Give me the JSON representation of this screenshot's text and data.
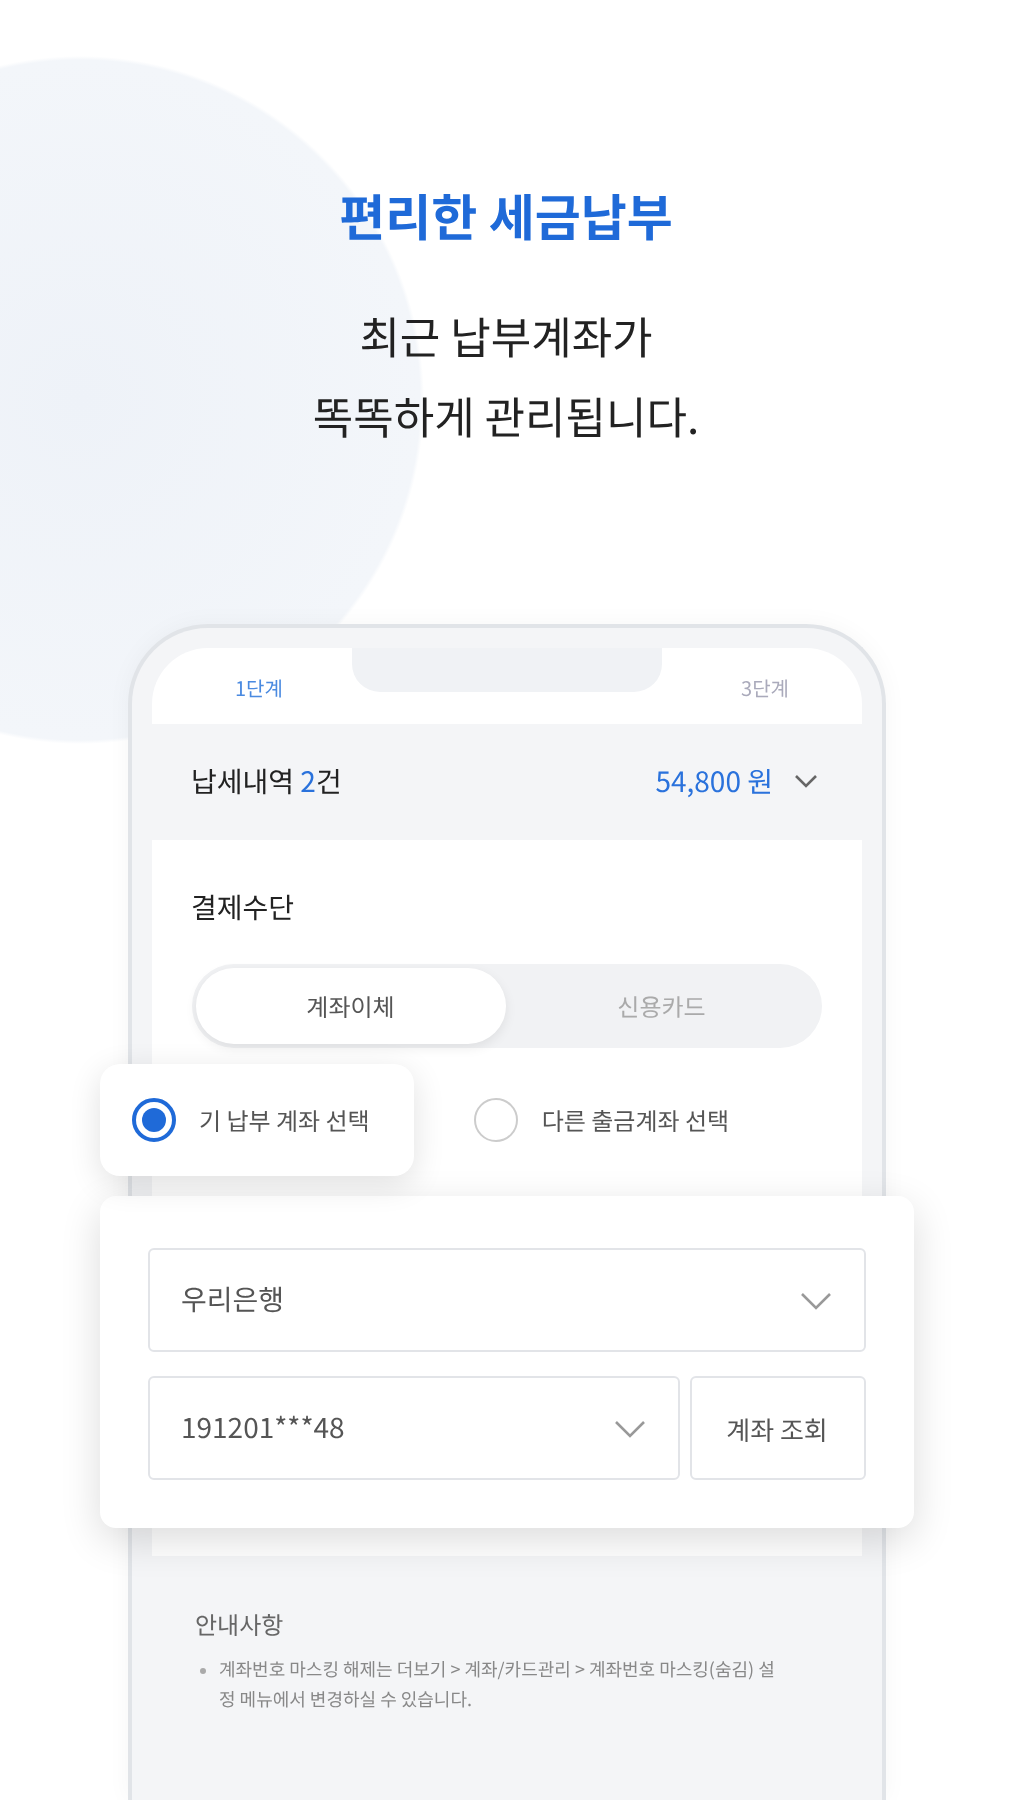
{
  "headline": "편리한 세금납부",
  "subtitle": [
    "최근 납부계좌가",
    "똑똑하게 관리됩니다."
  ],
  "phone": {
    "steps": [
      {
        "label": "1단계",
        "selected": true
      },
      {
        "label": "3단계",
        "selected": false
      }
    ],
    "summary": {
      "label": "납세내역",
      "count": "2",
      "unit": "건",
      "amount": "54,800 원"
    },
    "payment": {
      "title": "결제수단",
      "tabs": [
        {
          "label": "계좌이체",
          "selected": true
        },
        {
          "label": "신용카드",
          "selected": false
        }
      ]
    },
    "account_options": [
      {
        "label": "기 납부 계좌 선택",
        "selected": true
      },
      {
        "label": "다른 출금계좌 선택",
        "selected": false
      }
    ],
    "bank_select": {
      "value": "우리은행"
    },
    "account_select": {
      "value": "191201***48"
    },
    "lookup_button": "계좌 조회",
    "notice": {
      "title": "안내사항",
      "items": [
        "계좌번호 마스킹 해제는 더보기 > 계좌/카드관리 > 계좌번호 마스킹(숨김) 설정 메뉴에서 변경하실 수 있습니다."
      ]
    }
  }
}
